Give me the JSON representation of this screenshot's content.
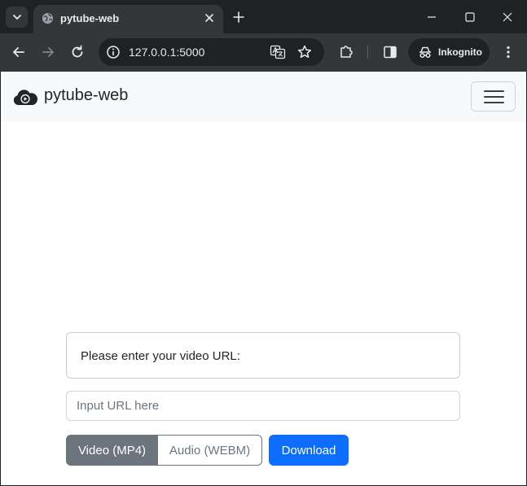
{
  "browser": {
    "tab_title": "pytube-web",
    "url": "127.0.0.1:5000",
    "profile_label": "Inkognito",
    "icons": [
      "tab-search-icon",
      "globe-icon",
      "close-icon",
      "plus-icon",
      "minimize-icon",
      "maximize-icon",
      "close-window-icon",
      "back-icon",
      "forward-icon",
      "reload-icon",
      "info-icon",
      "translate-icon",
      "star-icon",
      "extensions-icon",
      "side-panel-icon",
      "incognito-icon",
      "kebab-menu-icon"
    ]
  },
  "navbar": {
    "brand": "pytube-web",
    "icons": [
      "cloud-play-logo",
      "hamburger-icon"
    ]
  },
  "form": {
    "prompt": "Please enter your video URL:",
    "input_placeholder": "Input URL here",
    "input_value": "",
    "format_options": [
      "Video (MP4)",
      "Audio (WEBM)"
    ],
    "selected_format": "Video (MP4)",
    "download_label": "Download"
  },
  "colors": {
    "chrome_dark": "#202124",
    "chrome_toolbar": "#35363a",
    "navbar_bg": "#f8f9fa",
    "secondary": "#6c757d",
    "primary": "#0d6efd"
  }
}
